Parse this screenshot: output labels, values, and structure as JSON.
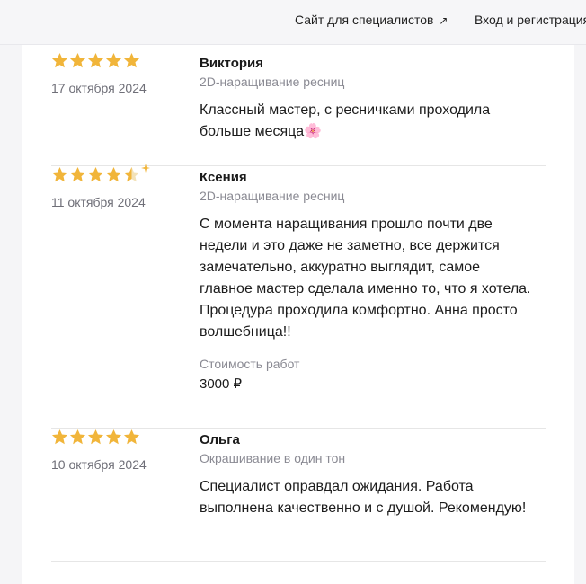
{
  "header": {
    "specialists_link": "Сайт для специалистов",
    "specialists_icon": "external-link-arrow-icon",
    "login_link": "Вход и регистрация"
  },
  "colors": {
    "star": "#F1B53A",
    "date": "#6f6f78",
    "service": "#8a8a93"
  },
  "reviews": [
    {
      "rating": 5,
      "date": "17 октября 2024",
      "name": "Виктория",
      "service": "2D-наращивание ресниц",
      "text": "Классный мастер, с ресничками проходила\nбольше месяца",
      "emoji": "🌸"
    },
    {
      "rating": 4.5,
      "date": "11 октября 2024",
      "name": "Ксения",
      "service": "2D-наращивание ресниц",
      "text": "С момента наращивания прошло почти две\nнедели и это даже не заметно, все держится\nзамечательно, аккуратно выглядит, самое\nглавное мастер сделала именно то, что я хотела.\nПроцедура проходила комфортно. Анна просто\nволшебница!!",
      "cost_label": "Стоимость работ",
      "cost_value": "3000 ₽"
    },
    {
      "rating": 5,
      "date": "10 октября 2024",
      "name": "Ольга",
      "service": "Окрашивание в один тон",
      "text": "Специалист оправдал ожидания. Работа\nвыполнена качественно и с душой. Рекомендую!"
    }
  ]
}
